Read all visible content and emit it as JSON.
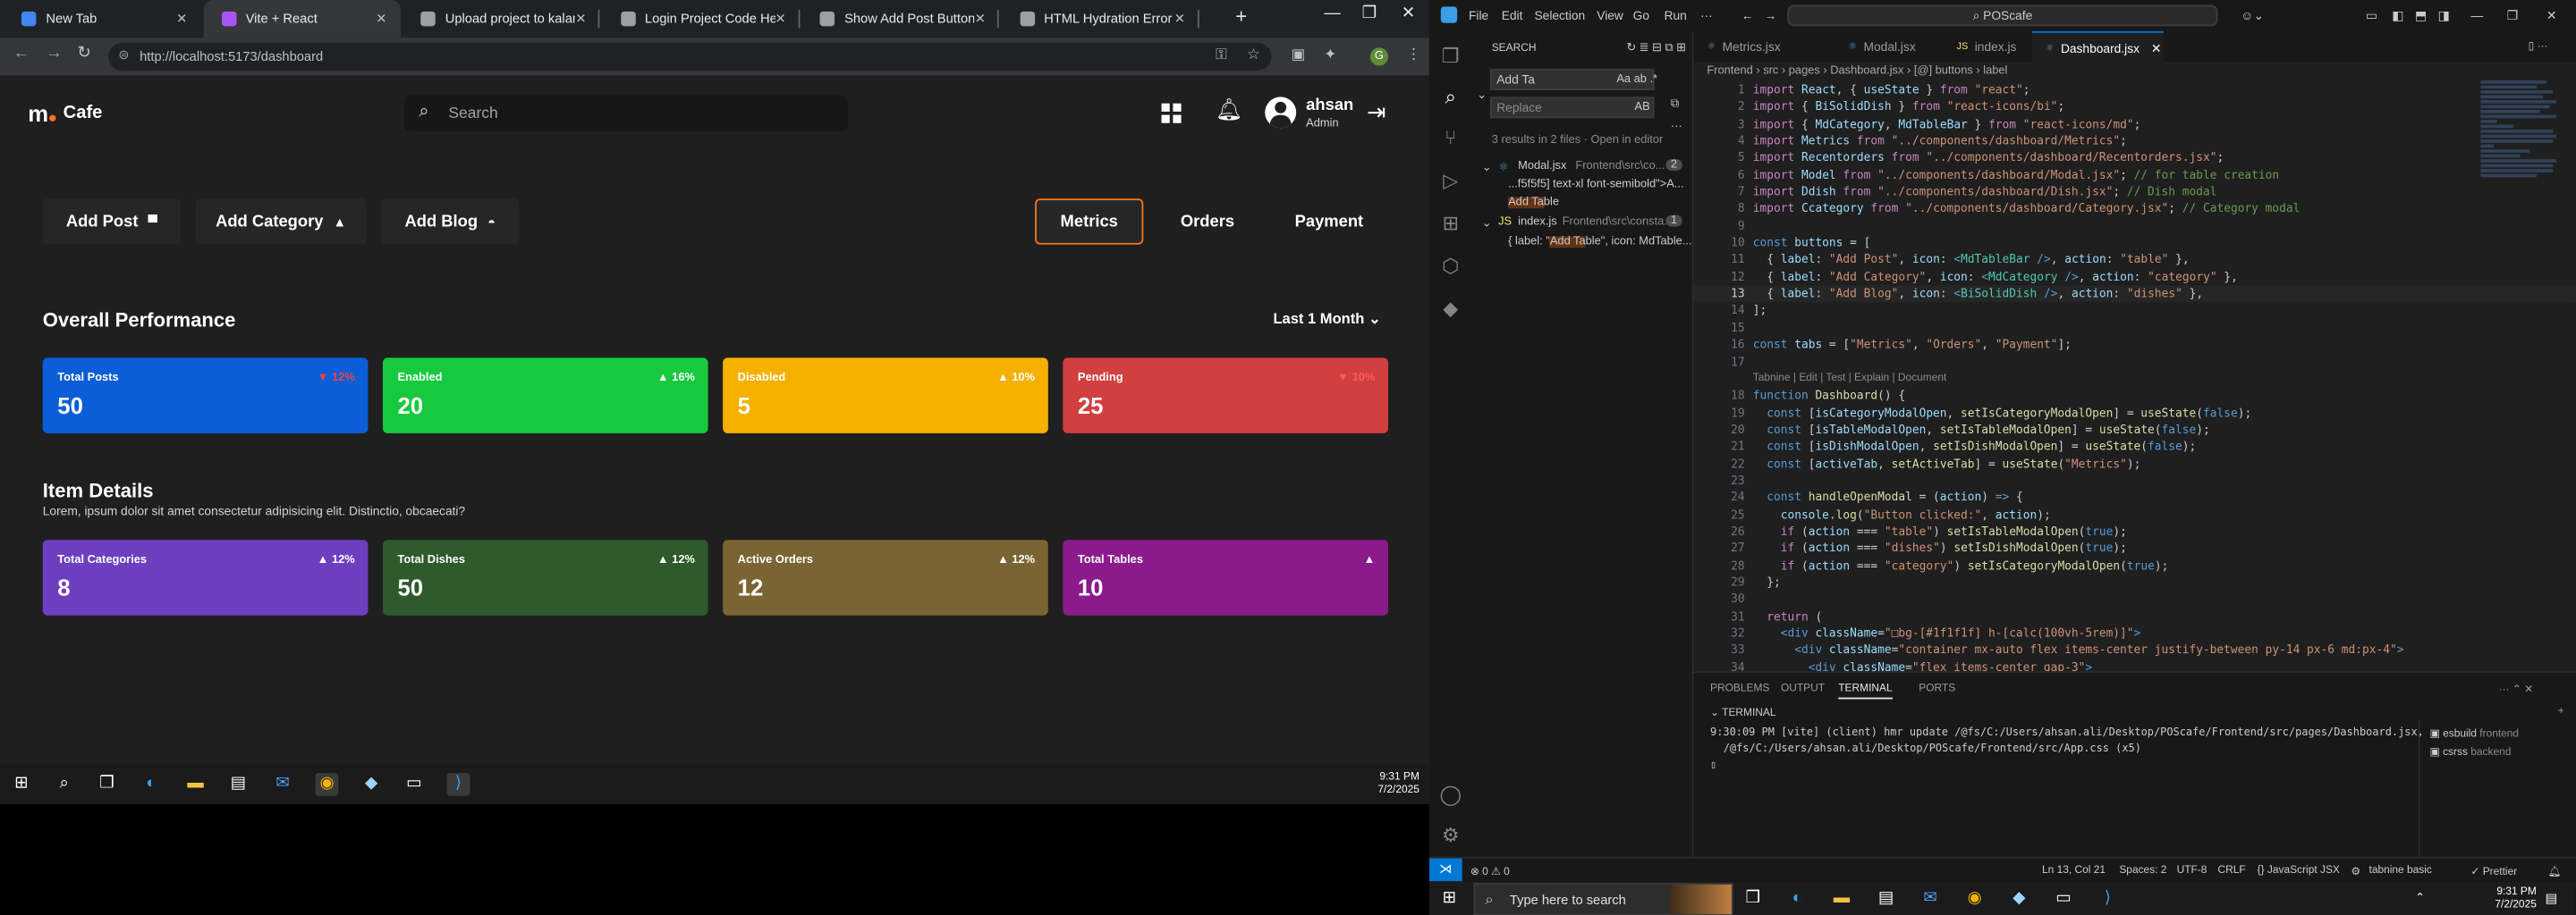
{
  "browser": {
    "tabs": [
      {
        "title": "New Tab",
        "fav": "#4285f4"
      },
      {
        "title": "Vite + React",
        "fav": "#a855f7"
      },
      {
        "title": "Upload project to kalams.org",
        "fav": "#9aa0a6"
      },
      {
        "title": "Login Project Code Help",
        "fav": "#9aa0a6"
      },
      {
        "title": "Show Add Post Button",
        "fav": "#9aa0a6"
      },
      {
        "title": "HTML Hydration Error Fix",
        "fav": "#9aa0a6"
      }
    ],
    "active_tab": 1,
    "url": "http://localhost:5173/dashboard",
    "new_tab_glyph": "+",
    "close_glyph": "✕"
  },
  "app": {
    "logo_letter": "m",
    "logo_text": "Cafe",
    "search_placeholder": "Search",
    "user_name": "ahsan",
    "user_role": "Admin",
    "action_buttons": [
      {
        "label": "Add Post",
        "icon": "table-bar-icon",
        "glyph": "▀"
      },
      {
        "label": "Add Category",
        "icon": "category-icon",
        "glyph": "▲"
      },
      {
        "label": "Add Blog",
        "icon": "dish-icon",
        "glyph": "◓"
      }
    ],
    "tabs": [
      "Metrics",
      "Orders",
      "Payment"
    ],
    "active_tab": "Metrics",
    "overall_title": "Overall Performance",
    "period": "Last 1 Month ⌄",
    "performance_cards": [
      {
        "label": "Total Posts",
        "value": "50",
        "change": "▼ 12%",
        "color": "#0b5ed7",
        "change_color": "#ef4444"
      },
      {
        "label": "Enabled",
        "value": "20",
        "change": "▲ 16%",
        "color": "#16c93e",
        "change_color": "#ffffff"
      },
      {
        "label": "Disabled",
        "value": "5",
        "change": "▲ 10%",
        "color": "#f5b000",
        "change_color": "#ffffff"
      },
      {
        "label": "Pending",
        "value": "25",
        "change": "▼ 10%",
        "color": "#d23f3f",
        "change_color": "#ff5a5a"
      }
    ],
    "details_title": "Item Details",
    "details_subtitle": "Lorem, ipsum dolor sit amet consectetur adipisicing elit. Distinctio, obcaecati?",
    "detail_cards": [
      {
        "label": "Total Categories",
        "value": "8",
        "change": "▲ 12%",
        "color": "#6d3fc0"
      },
      {
        "label": "Total Dishes",
        "value": "50",
        "change": "▲ 12%",
        "color": "#2f5a2c"
      },
      {
        "label": "Active Orders",
        "value": "12",
        "change": "▲ 12%",
        "color": "#7a6433"
      },
      {
        "label": "Total Tables",
        "value": "10",
        "change": "▲",
        "color": "#8b1a8b"
      }
    ]
  },
  "taskbar_left": {
    "time": "9:31 PM",
    "date": "7/2/2025"
  },
  "vscode": {
    "menu": [
      "File",
      "Edit",
      "Selection",
      "View",
      "Go",
      "Run",
      "···"
    ],
    "command_center": "POScafe",
    "search": {
      "title": "SEARCH",
      "query": "Add Ta",
      "replace_placeholder": "Replace",
      "summary": "3 results in 2 files · Open in editor",
      "results": [
        {
          "file": "Modal.jsx",
          "path": "Frontend\\src\\co...",
          "count": "2"
        },
        {
          "line": "...f5f5f5] text-xl font-semibold\">A...",
          "indent": true
        },
        {
          "match": "Add Ta",
          "rest": "ble",
          "indent": true
        },
        {
          "file": "index.js",
          "path": "Frontend\\src\\consta...",
          "count": "1"
        },
        {
          "pre": "{ label: \"",
          "match": "Add Ta",
          "rest": "ble\", icon: MdTable...",
          "indent": true
        }
      ]
    },
    "editor_tabs": [
      "Metrics.jsx",
      "Modal.jsx",
      "index.js",
      "Dashboard.jsx"
    ],
    "active_editor_tab": "Dashboard.jsx",
    "breadcrumb": "Frontend › src › pages › Dashboard.jsx › [@] buttons › label",
    "codelens": "Tabnine | Edit | Test | Explain | Document",
    "panel_tabs": [
      "PROBLEMS",
      "OUTPUT",
      "TERMINAL",
      "PORTS"
    ],
    "active_panel_tab": "TERMINAL",
    "terminal_title": "TERMINAL",
    "terminal_lines": [
      "9:30:09 PM [vite] (client) hmr update /@fs/C:/Users/ahsan.ali/Desktop/POScafe/Frontend/src/pages/Dashboard.jsx,",
      "/@fs/C:/Users/ahsan.ali/Desktop/POScafe/Frontend/src/App.css (x5)"
    ],
    "terminal_list": [
      {
        "name": "esbuild",
        "sub": "frontend"
      },
      {
        "name": "csrss",
        "sub": "backend"
      }
    ],
    "status_left": "⊗ 0 ⚠ 0",
    "status_items": [
      "Ln 13, Col 21",
      "Spaces: 2",
      "UTF-8",
      "CRLF",
      "{} JavaScript JSX",
      "tabnine basic",
      "✓ Prettier"
    ]
  },
  "taskbar_right": {
    "search_placeholder": "Type here to search",
    "time": "9:31 PM",
    "date": "7/2/2025"
  }
}
